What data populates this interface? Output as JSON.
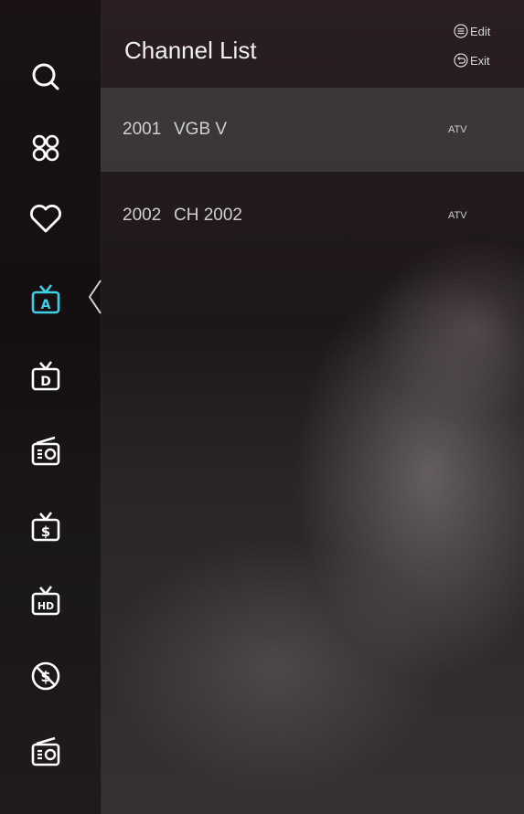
{
  "header": {
    "title": "Channel List",
    "edit_label": "Edit",
    "exit_label": "Exit"
  },
  "sidebar": {
    "items": [
      {
        "icon": "search-icon"
      },
      {
        "icon": "apps-icon"
      },
      {
        "icon": "heart-icon"
      },
      {
        "icon": "tv-analog-icon",
        "letter": "A",
        "selected": true
      },
      {
        "icon": "tv-digital-icon",
        "letter": "D"
      },
      {
        "icon": "radio-icon"
      },
      {
        "icon": "tv-pay-icon",
        "letter": "$"
      },
      {
        "icon": "tv-hd-icon",
        "letter": "HD"
      },
      {
        "icon": "free-icon",
        "letter": "$"
      },
      {
        "icon": "radio-icon"
      }
    ]
  },
  "channels": [
    {
      "number": "2001",
      "name": "VGB V",
      "type": "ATV"
    },
    {
      "number": "2002",
      "name": "CH 2002",
      "type": "ATV"
    }
  ],
  "colors": {
    "accent": "#3fd0e6",
    "icon": "#ffffff",
    "selected_row": "#413e40"
  }
}
